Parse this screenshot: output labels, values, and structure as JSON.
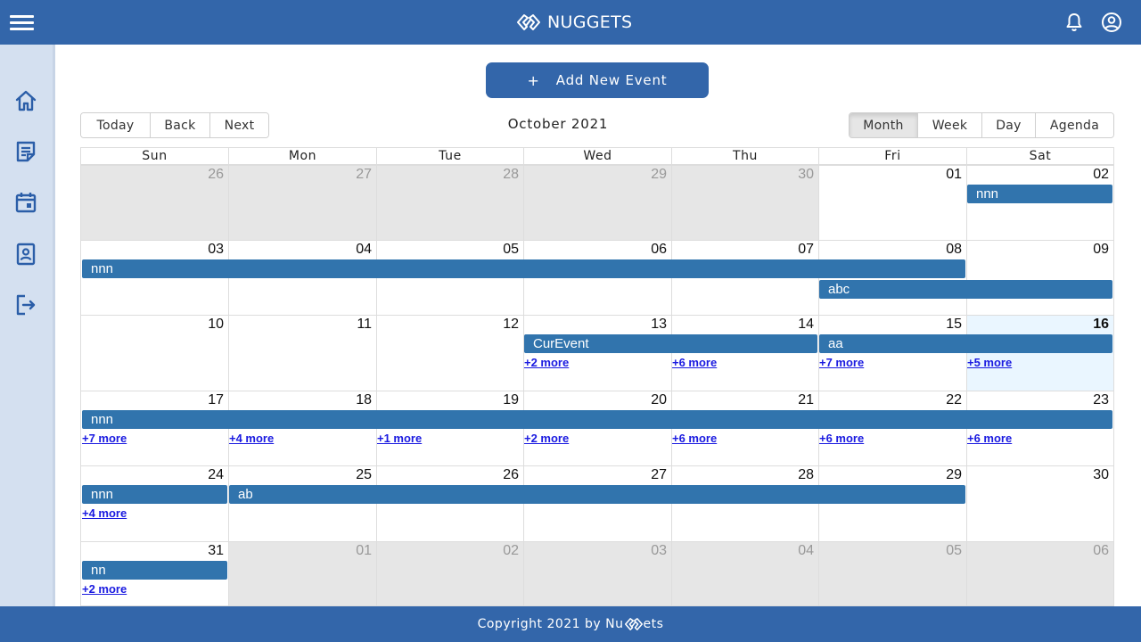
{
  "header": {
    "brand": "NUGGETS",
    "menu_icon": "hamburger-menu-icon",
    "notification_icon": "bell-icon",
    "account_icon": "account-circle-icon"
  },
  "sidebar": {
    "items": [
      {
        "icon": "home-icon"
      },
      {
        "icon": "note-icon"
      },
      {
        "icon": "calendar-icon"
      },
      {
        "icon": "contact-icon"
      },
      {
        "icon": "logout-icon"
      }
    ]
  },
  "toolbar": {
    "add_event_label": "Add New Event",
    "add_event_icon": "+",
    "nav": [
      "Today",
      "Back",
      "Next"
    ],
    "month_label": "October 2021",
    "views": [
      "Month",
      "Week",
      "Day",
      "Agenda"
    ],
    "active_view": "Month"
  },
  "calendar": {
    "weekdays": [
      "Sun",
      "Mon",
      "Tue",
      "Wed",
      "Thu",
      "Fri",
      "Sat"
    ],
    "today": "16",
    "weeks": [
      [
        "26",
        "27",
        "28",
        "29",
        "30",
        "01",
        "02"
      ],
      [
        "03",
        "04",
        "05",
        "06",
        "07",
        "08",
        "09"
      ],
      [
        "10",
        "11",
        "12",
        "13",
        "14",
        "15",
        "16"
      ],
      [
        "17",
        "18",
        "19",
        "20",
        "21",
        "22",
        "23"
      ],
      [
        "24",
        "25",
        "26",
        "27",
        "28",
        "29",
        "30"
      ],
      [
        "31",
        "01",
        "02",
        "03",
        "04",
        "05",
        "06"
      ]
    ],
    "off_month": [
      [
        true,
        true,
        true,
        true,
        true,
        false,
        false
      ],
      [
        false,
        false,
        false,
        false,
        false,
        false,
        false
      ],
      [
        false,
        false,
        false,
        false,
        false,
        false,
        false
      ],
      [
        false,
        false,
        false,
        false,
        false,
        false,
        false
      ],
      [
        false,
        false,
        false,
        false,
        false,
        false,
        false
      ],
      [
        false,
        true,
        true,
        true,
        true,
        true,
        true
      ]
    ],
    "events": [
      {
        "title": "nnn",
        "week": 0,
        "start": 6,
        "span": 1,
        "slot": 0
      },
      {
        "title": "nnn",
        "week": 1,
        "start": 0,
        "span": 6,
        "slot": 0
      },
      {
        "title": "abc",
        "week": 1,
        "start": 5,
        "span": 2,
        "slot": 1
      },
      {
        "title": "CurEvent",
        "week": 2,
        "start": 3,
        "span": 2,
        "slot": 0
      },
      {
        "title": "aa",
        "week": 2,
        "start": 5,
        "span": 2,
        "slot": 0
      },
      {
        "title": "nnn",
        "week": 3,
        "start": 0,
        "span": 7,
        "slot": 0
      },
      {
        "title": "nnn",
        "week": 4,
        "start": 0,
        "span": 1,
        "slot": 0
      },
      {
        "title": "ab",
        "week": 4,
        "start": 1,
        "span": 5,
        "slot": 0
      },
      {
        "title": "nn",
        "week": 5,
        "start": 0,
        "span": 1,
        "slot": 0
      }
    ],
    "more_links": [
      {
        "label": "+2 more",
        "week": 2,
        "day": 3
      },
      {
        "label": "+6 more",
        "week": 2,
        "day": 4
      },
      {
        "label": "+7 more",
        "week": 2,
        "day": 5
      },
      {
        "label": "+5 more",
        "week": 2,
        "day": 6
      },
      {
        "label": "+7 more",
        "week": 3,
        "day": 0
      },
      {
        "label": "+4 more",
        "week": 3,
        "day": 1
      },
      {
        "label": "+1 more",
        "week": 3,
        "day": 2
      },
      {
        "label": "+2 more",
        "week": 3,
        "day": 3
      },
      {
        "label": "+6 more",
        "week": 3,
        "day": 4
      },
      {
        "label": "+6 more",
        "week": 3,
        "day": 5
      },
      {
        "label": "+6 more",
        "week": 3,
        "day": 6
      },
      {
        "label": "+4 more",
        "week": 4,
        "day": 0
      },
      {
        "label": "+2 more",
        "week": 5,
        "day": 0
      }
    ]
  },
  "footer": {
    "prefix": "Copyright 2021 by Nu",
    "suffix": "ets"
  },
  "colors": {
    "brand": "#3366aa",
    "event": "#3174ad",
    "sidebar": "#d4e0f0",
    "off_day": "#e6e6e6",
    "today": "#eaf6ff",
    "more_link": "#1a1ae0"
  }
}
